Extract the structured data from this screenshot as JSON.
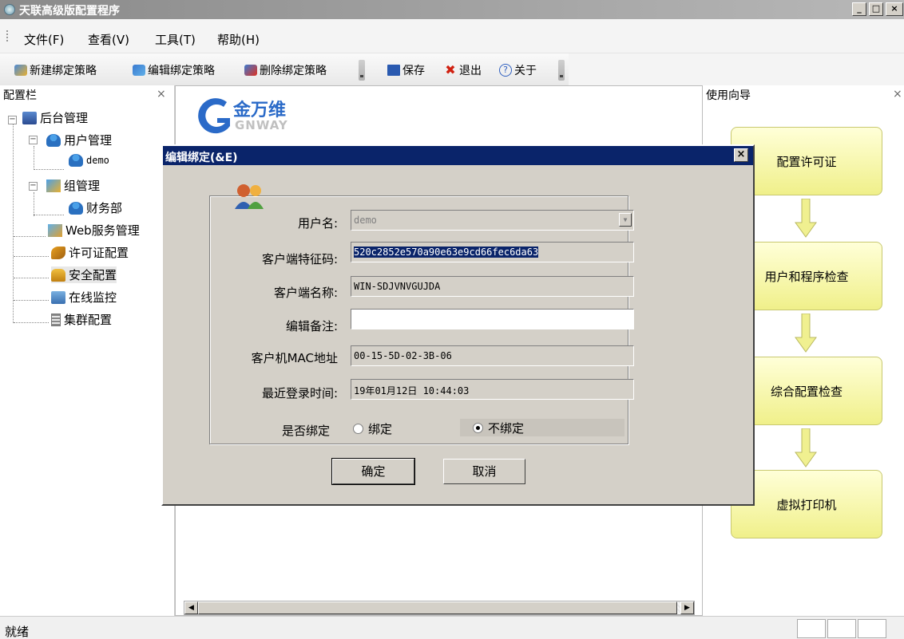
{
  "window": {
    "title": "天联高级版配置程序",
    "min": "_",
    "max": "□",
    "close": "×"
  },
  "menu": [
    "文件(F)",
    "查看(V)",
    "工具(T)",
    "帮助(H)"
  ],
  "toolbar": {
    "new_policy": "新建绑定策略",
    "edit_policy": "编辑绑定策略",
    "delete_policy": "删除绑定策略",
    "save": "保存",
    "exit": "退出",
    "about": "关于"
  },
  "left_panel": {
    "title": "配置栏",
    "close": "×",
    "tree": {
      "root": "后台管理",
      "user_mgmt": "用户管理",
      "user_demo": "demo",
      "group_mgmt": "组管理",
      "group_finance": "财务部",
      "web_service": "Web服务管理",
      "license": "许可证配置",
      "security": "安全配置",
      "online_monitor": "在线监控",
      "cluster": "集群配置"
    }
  },
  "center_panel": {
    "logo_cn": "金万维",
    "logo_en": "GNWAY"
  },
  "right_panel": {
    "title": "使用向导",
    "close": "×",
    "steps": [
      "配置许可证",
      "用户和程序检查",
      "综合配置检查",
      "虚拟打印机"
    ]
  },
  "dialog": {
    "title": "编辑绑定(&E)",
    "close": "×",
    "fields": {
      "username_label": "用户名:",
      "username_value": "demo",
      "client_code_label": "客户端特征码:",
      "client_code_value": "520c2852e570a90e63e9cd66fec6da63",
      "client_name_label": "客户端名称:",
      "client_name_value": "WIN-SDJVNVGUJDA",
      "note_label": "编辑备注:",
      "note_value": "",
      "mac_label": "客户机MAC地址",
      "mac_value": "00-15-5D-02-3B-06",
      "last_login_label": "最近登录时间:",
      "last_login_value": "19年01月12日 10:44:03",
      "bind_label": "是否绑定",
      "bind_option": "绑定",
      "unbind_option": "不绑定",
      "selected": "不绑定"
    },
    "ok": "确定",
    "cancel": "取消"
  },
  "status": {
    "text": "就绪"
  },
  "colors": {
    "dialog_title_bg": "#0a246a",
    "flow_box": "#f0f08a",
    "selection": "#0a246a"
  }
}
